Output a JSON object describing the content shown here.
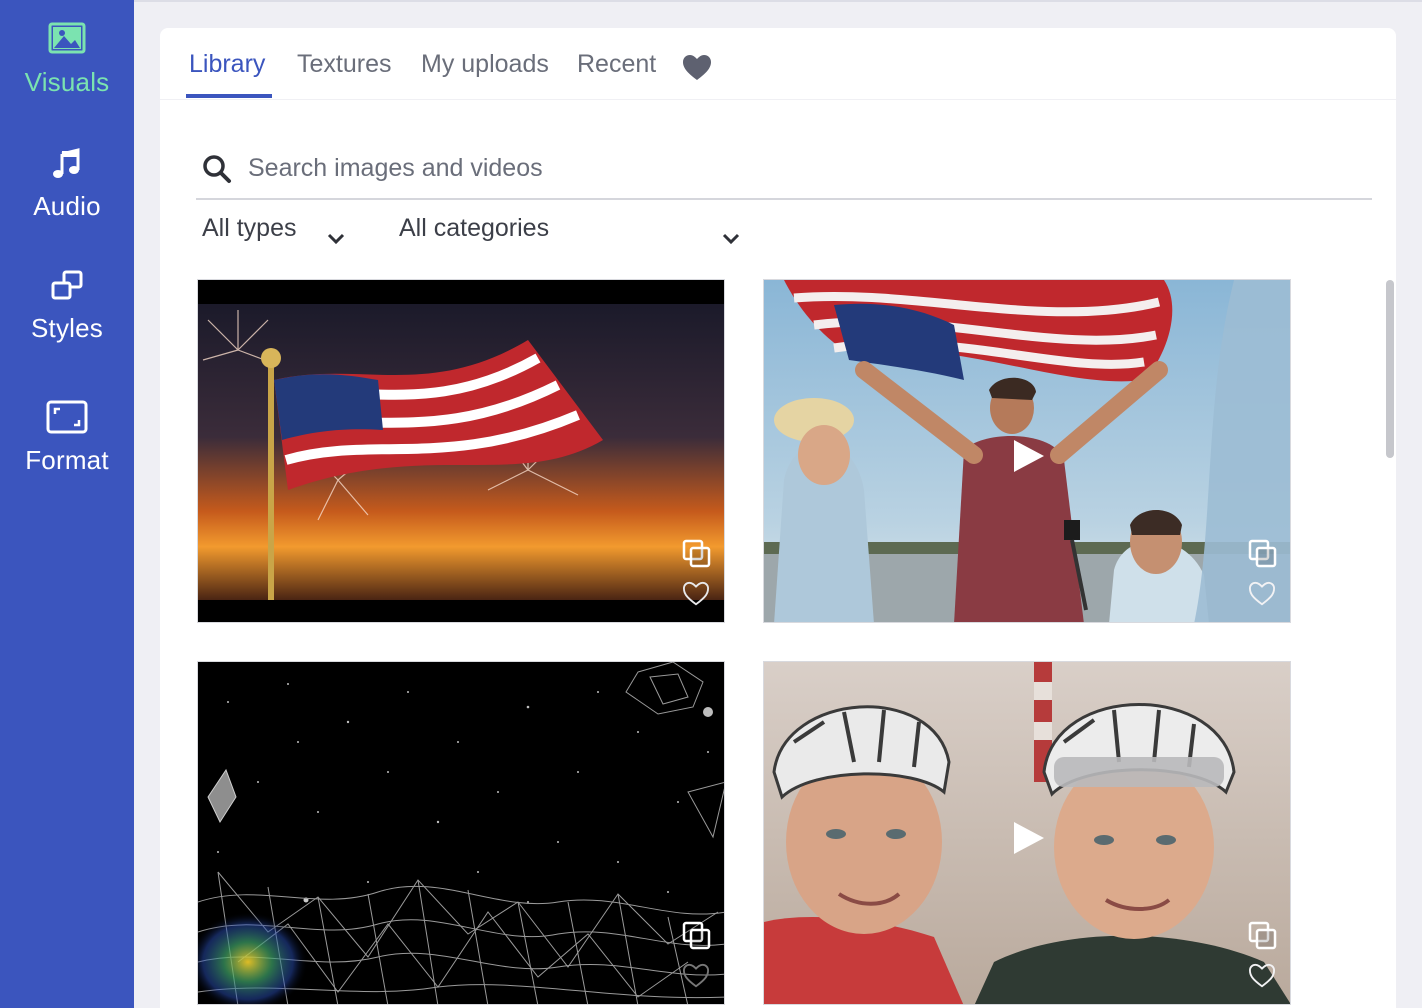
{
  "sidebar": {
    "items": [
      {
        "label": "Visuals",
        "icon": "image-icon",
        "active": true
      },
      {
        "label": "Audio",
        "icon": "music-note-icon",
        "active": false
      },
      {
        "label": "Styles",
        "icon": "styles-icon",
        "active": false
      },
      {
        "label": "Format",
        "icon": "format-frame-icon",
        "active": false
      }
    ]
  },
  "tabs": {
    "items": [
      {
        "label": "Library",
        "active": true
      },
      {
        "label": "Textures",
        "active": false
      },
      {
        "label": "My uploads",
        "active": false
      },
      {
        "label": "Recent",
        "active": false
      }
    ],
    "favorites_icon": "heart-icon"
  },
  "search": {
    "placeholder": "Search images and videos",
    "value": ""
  },
  "filters": {
    "type_label": "All types",
    "category_label": "All categories"
  },
  "colors": {
    "sidebar_bg": "#3b55be",
    "accent": "#3b55be",
    "active_sidebar_label": "#7be3b0",
    "page_bg": "#efeff4"
  },
  "media": [
    {
      "kind": "image",
      "subject": "American flag with fireworks at sunset"
    },
    {
      "kind": "video",
      "subject": "Man waving American flag on boat"
    },
    {
      "kind": "video",
      "subject": "Low-poly wireframe terrain in starry space"
    },
    {
      "kind": "video",
      "subject": "Two cyclists in helmets smiling"
    }
  ]
}
